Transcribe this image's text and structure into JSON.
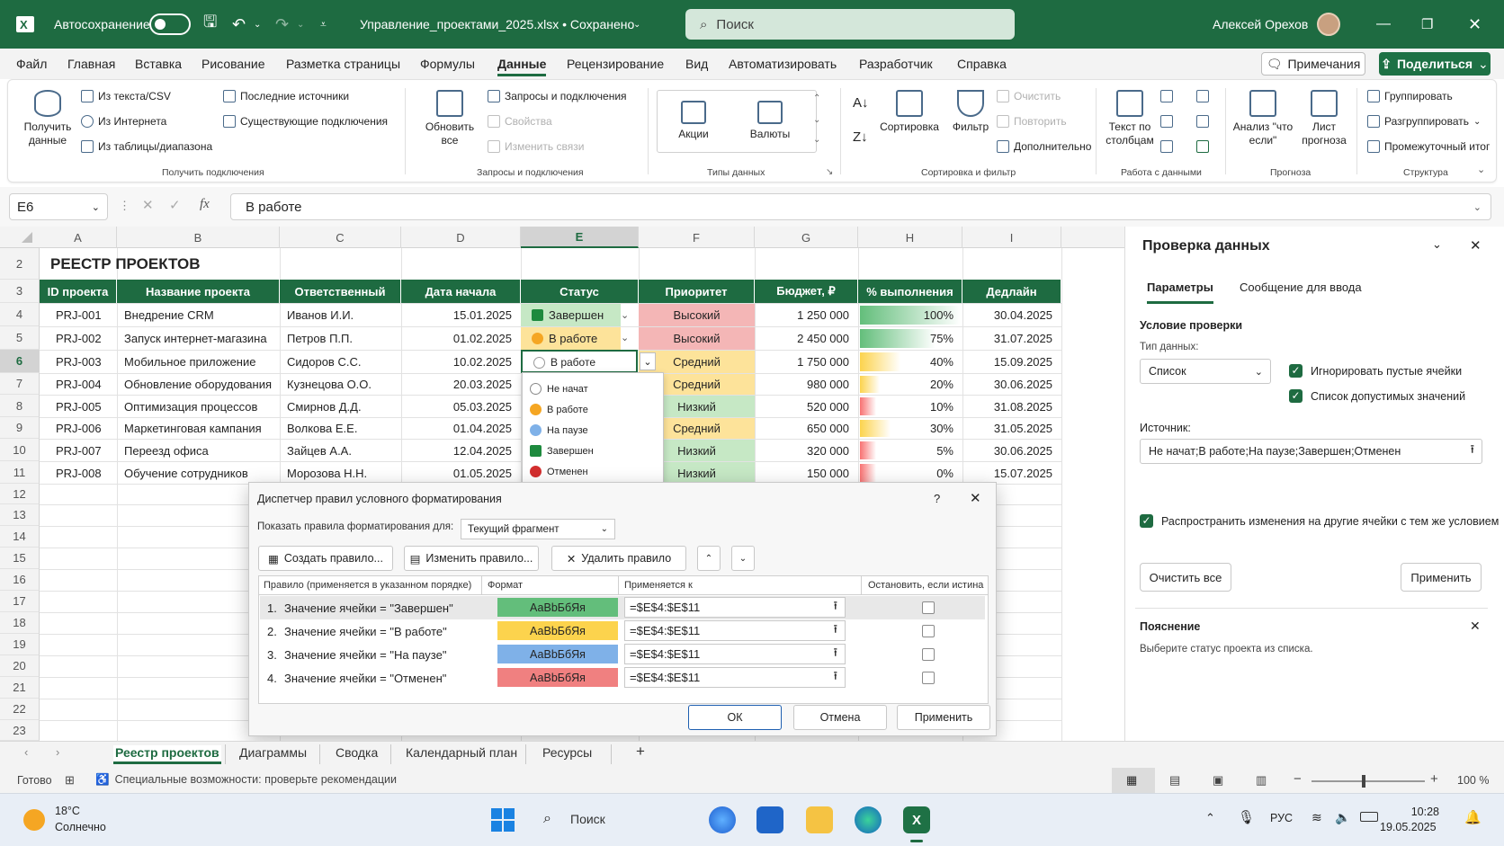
{
  "titlebar": {
    "autosave_label": "Автосохранение",
    "filename": "Управление_проектами_2025.xlsx • Сохранено",
    "search_placeholder": "Поиск",
    "user_name": "Алексей Орехов"
  },
  "menu": {
    "items": [
      "Файл",
      "Главная",
      "Вставка",
      "Рисование",
      "Разметка страницы",
      "Формулы",
      "Данные",
      "Рецензирование",
      "Вид",
      "Автоматизировать",
      "Разработчик",
      "Справка"
    ],
    "active": "Данные",
    "notes_label": "Примечания",
    "share_label": "Поделиться"
  },
  "ribbon": {
    "get_data_label": "Получить\nданные",
    "from_text": "Из текста/CSV",
    "from_web": "Из Интернета",
    "from_table": "Из таблицы/диапазона",
    "recent_sources": "Последние источники",
    "existing_connections": "Существующие подключения",
    "group_get": "Получить подключения",
    "refresh_all": "Обновить\nвсе",
    "queries_connections": "Запросы и подключения",
    "properties": "Свойства",
    "edit_links": "Изменить связи",
    "group_queries": "Запросы и подключения",
    "stocks": "Акции",
    "currencies": "Валюты",
    "group_types": "Типы данных",
    "sort": "Сортировка",
    "filter": "Фильтр",
    "clear": "Очистить",
    "reapply": "Повторить",
    "advanced": "Дополнительно",
    "group_sort": "Сортировка и фильтр",
    "text_to_columns": "Текст по\nстолбцам",
    "group_tools": "Работа с данными",
    "whatif": "Анализ \"что\nесли\"",
    "forecast": "Лист\nпрогноза",
    "group_forecast": "Прогноза",
    "group_btn": "Группировать",
    "ungroup_btn": "Разгруппировать",
    "subtotal": "Промежуточный итог",
    "group_structure": "Структура"
  },
  "formula_bar": {
    "name_box": "E6",
    "content": "В работе"
  },
  "grid": {
    "columns": [
      "A",
      "B",
      "C",
      "D",
      "E",
      "F",
      "G",
      "H",
      "I"
    ],
    "rows": [
      "2",
      "3",
      "4",
      "5",
      "6",
      "7",
      "8",
      "9",
      "10",
      "11",
      "12",
      "13",
      "14",
      "15",
      "16",
      "17",
      "18",
      "19",
      "20",
      "21",
      "22",
      "23"
    ],
    "title": "РЕЕСТР ПРОЕКТОВ",
    "headers": [
      "ID проекта",
      "Название проекта",
      "Ответственный",
      "Дата начала",
      "Статус",
      "Приоритет",
      "Бюджет, ₽",
      "% выполнения",
      "Дедлайн"
    ],
    "data": [
      {
        "id": "PRJ-001",
        "name": "Внедрение CRM",
        "owner": "Иванов И.И.",
        "start": "15.01.2025",
        "status": "Завершен",
        "priority": "Высокий",
        "budget": "1 250 000",
        "pct_label": "100%",
        "pct": 1.0,
        "deadline": "30.04.2025"
      },
      {
        "id": "PRJ-002",
        "name": "Запуск интернет-магазина",
        "owner": "Петров П.П.",
        "start": "01.02.2025",
        "status": "В работе",
        "priority": "Высокий",
        "budget": "2 450 000",
        "pct_label": "75%",
        "pct": 0.75,
        "deadline": "31.07.2025"
      },
      {
        "id": "PRJ-003",
        "name": "Мобильное приложение",
        "owner": "Сидоров С.С.",
        "start": "10.02.2025",
        "status": "В работе",
        "priority": "Средний",
        "budget": "1 750 000",
        "pct_label": "40%",
        "pct": 0.4,
        "deadline": "15.09.2025"
      },
      {
        "id": "PRJ-004",
        "name": "Обновление оборудования",
        "owner": "Кузнецова О.О.",
        "start": "20.03.2025",
        "status": "",
        "priority": "Средний",
        "budget": "980 000",
        "pct_label": "20%",
        "pct": 0.2,
        "deadline": "30.06.2025"
      },
      {
        "id": "PRJ-005",
        "name": "Оптимизация процессов",
        "owner": "Смирнов Д.Д.",
        "start": "05.03.2025",
        "status": "",
        "priority": "Низкий",
        "budget": "520 000",
        "pct_label": "10%",
        "pct": 0.1,
        "deadline": "31.08.2025"
      },
      {
        "id": "PRJ-006",
        "name": "Маркетинговая кампания",
        "owner": "Волкова Е.Е.",
        "start": "01.04.2025",
        "status": "",
        "priority": "Средний",
        "budget": "650 000",
        "pct_label": "30%",
        "pct": 0.3,
        "deadline": "31.05.2025"
      },
      {
        "id": "PRJ-007",
        "name": "Переезд офиса",
        "owner": "Зайцев А.А.",
        "start": "12.04.2025",
        "status": "",
        "priority": "Низкий",
        "budget": "320 000",
        "pct_label": "5%",
        "pct": 0.05,
        "deadline": "30.06.2025"
      },
      {
        "id": "PRJ-008",
        "name": "Обучение сотрудников",
        "owner": "Морозова Н.Н.",
        "start": "01.05.2025",
        "status": "",
        "priority": "Низкий",
        "budget": "150 000",
        "pct_label": "0%",
        "pct": 0.0,
        "deadline": "15.07.2025"
      }
    ],
    "dropdown_options": [
      "Не начат",
      "В работе",
      "На паузе",
      "Завершен",
      "Отменен"
    ]
  },
  "colors": {
    "excel_green": "#1e6b41",
    "high_priority": "#f4b6b6",
    "medium_priority": "#fde39a",
    "low_priority": "#c6e8c5",
    "done_status": "#c6e8c5",
    "inprogress_status": "#fde39a",
    "pct_green": "#63be7b",
    "pct_yellow": "#fcd34d",
    "pct_red": "#f87171"
  },
  "panel": {
    "title": "Проверка данных",
    "tab_params": "Параметры",
    "tab_input_msg": "Сообщение для ввода",
    "condition_label": "Условие проверки",
    "data_type_label": "Тип данных:",
    "data_type_value": "Список",
    "ignore_blank": "Игнорировать пустые ячейки",
    "in_cell_dropdown": "Список допустимых значений",
    "source_label": "Источник:",
    "source_value": "Не начат;В работе;На паузе;Завершен;Отменен",
    "apply_to_all": "Распространить изменения на другие ячейки с тем же условием",
    "clear_all": "Очистить все",
    "apply": "Применить",
    "note_title": "Пояснение",
    "note_text": "Выберите статус проекта из списка."
  },
  "dialog": {
    "title": "Диспетчер правил условного форматирования",
    "help": "?",
    "show_rules_label": "Показать правила форматирования для:",
    "show_rules_value": "Текущий фрагмент",
    "new_rule": "Создать правило...",
    "edit_rule": "Изменить правило...",
    "delete_rule": "Удалить правило",
    "col_rule": "Правило (применяется в указанном порядке)",
    "col_format": "Формат",
    "col_applies": "Применяется к",
    "col_stop": "Остановить, если истина",
    "rules": [
      {
        "num": "1.",
        "rule": "Значение ячейки = \"Завершен\"",
        "sample": "АаВbБбЯя",
        "color": "#63be7b",
        "range": "=$E$4:$E$11"
      },
      {
        "num": "2.",
        "rule": "Значение ячейки = \"В работе\"",
        "sample": "АаВbБбЯя",
        "color": "#fcd34d",
        "range": "=$E$4:$E$11"
      },
      {
        "num": "3.",
        "rule": "Значение ячейки = \"На паузе\"",
        "sample": "АаВbБбЯя",
        "color": "#7fb1e8",
        "range": "=$E$4:$E$11"
      },
      {
        "num": "4.",
        "rule": "Значение ячейки = \"Отменен\"",
        "sample": "АаВbБбЯя",
        "color": "#f08080",
        "range": "=$E$4:$E$11"
      }
    ],
    "ok": "ОК",
    "cancel": "Отмена",
    "apply": "Применить"
  },
  "sheets": {
    "tabs": [
      "Реестр проектов",
      "Диаграммы",
      "Сводка",
      "Календарный план",
      "Ресурсы"
    ],
    "active": "Реестр проектов"
  },
  "status": {
    "ready": "Готово",
    "accessibility": "Специальные возможности: проверьте рекомендации",
    "zoom": "100 %"
  },
  "taskbar": {
    "weather_temp": "18°C",
    "weather_desc": "Солнечно",
    "search": "Поиск",
    "lang": "РУС",
    "time": "10:28",
    "date": "19.05.2025"
  }
}
